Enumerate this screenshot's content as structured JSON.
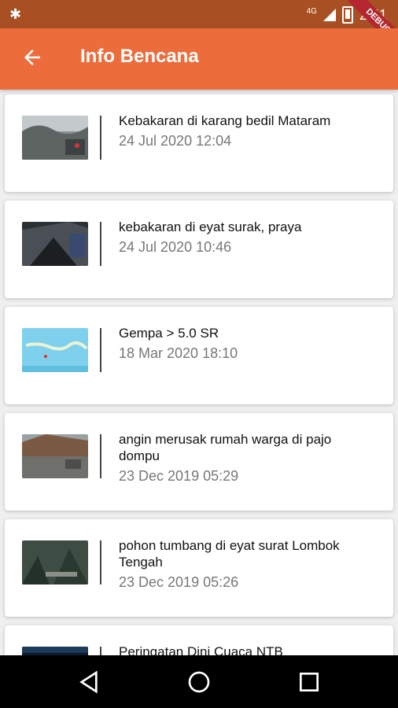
{
  "status": {
    "network": "4G",
    "time": "2:51",
    "debug_label": "DEBUG"
  },
  "app_bar": {
    "title": "Info Bencana"
  },
  "items": [
    {
      "title": "Kebakaran di karang bedil Mataram",
      "date": "24 Jul 2020 12:04"
    },
    {
      "title": "kebakaran di eyat surak, praya",
      "date": "24 Jul 2020 10:46"
    },
    {
      "title": "Gempa > 5.0 SR",
      "date": "18 Mar 2020 18:10"
    },
    {
      "title": "angin merusak rumah warga di pajo dompu",
      "date": "23 Dec 2019 05:29"
    },
    {
      "title": "pohon tumbang di eyat surat Lombok Tengah",
      "date": "23 Dec 2019 05:26"
    },
    {
      "title": "Peringatan Dini Cuaca NTB",
      "date": ""
    }
  ],
  "colors": {
    "app_bar": "#ec6c3b",
    "status_bar": "#a84f23",
    "background": "#efefef"
  }
}
